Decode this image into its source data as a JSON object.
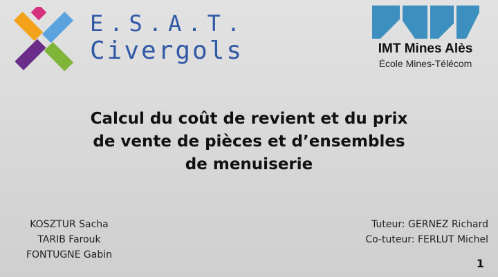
{
  "esat_logo": {
    "line1": "E.S.A.T.",
    "line2": "Civergols",
    "colors": {
      "magenta": "#d6307f",
      "purple": "#6a2d8a",
      "orange": "#f2a31b",
      "green": "#7fb539",
      "blue": "#5ba3df",
      "text": "#2f58a6"
    }
  },
  "imt_logo": {
    "name": "IMT Mines Alès",
    "subtitle": "École Mines-Télécom",
    "mark_color": "#3d8fc0"
  },
  "title_lines": [
    "Calcul du coût de revient et du prix",
    "de vente de pièces et d’ensembles",
    "de menuiserie"
  ],
  "authors": [
    "KOSZTUR Sacha",
    "TARIB Farouk",
    "FONTUGNE Gabin"
  ],
  "tutors": [
    "Tuteur: GERNEZ Richard",
    "Co-tuteur: FERLUT Michel"
  ],
  "page_number": "1"
}
